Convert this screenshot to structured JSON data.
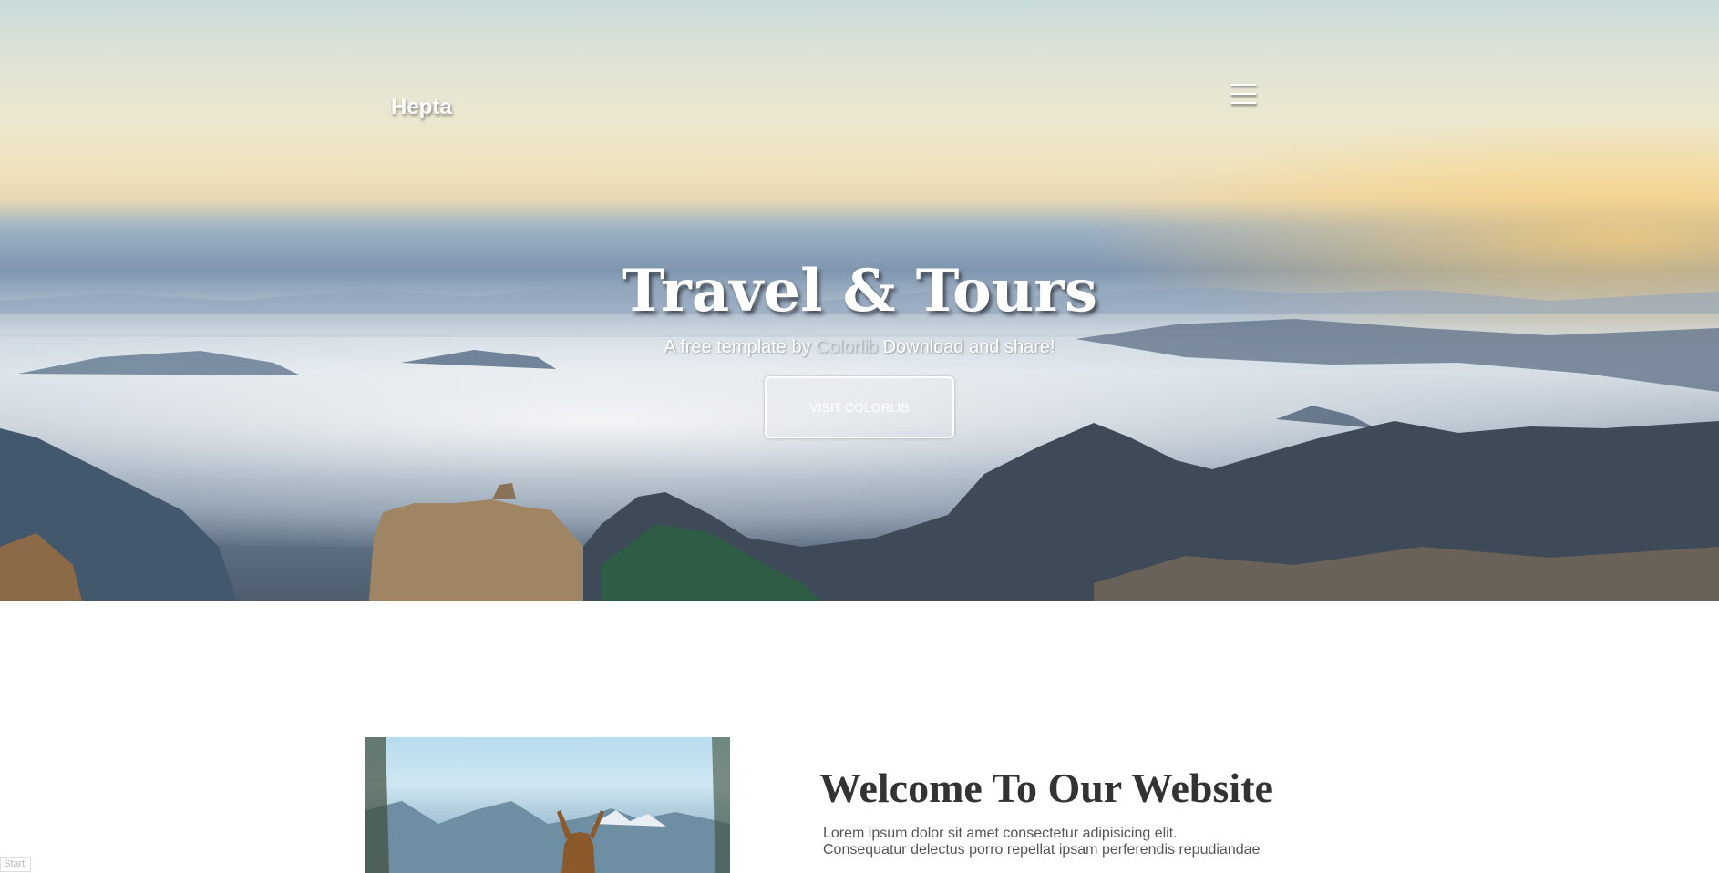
{
  "navbar": {
    "brand": "Hepta",
    "menu_icon": "hamburger-menu-icon"
  },
  "hero": {
    "title": "Travel & Tours",
    "subtitle_prefix": "A free template by",
    "subtitle_link": "Colorlib",
    "subtitle_suffix": "Download and share!",
    "button_label": "VISIT COLORLIB"
  },
  "welcome": {
    "title": "Welcome To Our Website",
    "text_line1": "Lorem ipsum dolor sit amet consectetur adipisicing elit.",
    "text_line2": "Consequatur delectus porro repellat ipsam perferendis repudiandae"
  },
  "status": {
    "start_label": "Start"
  },
  "colors": {
    "heading": "#333333",
    "body_text": "#555555",
    "hero_text": "#ffffff"
  }
}
